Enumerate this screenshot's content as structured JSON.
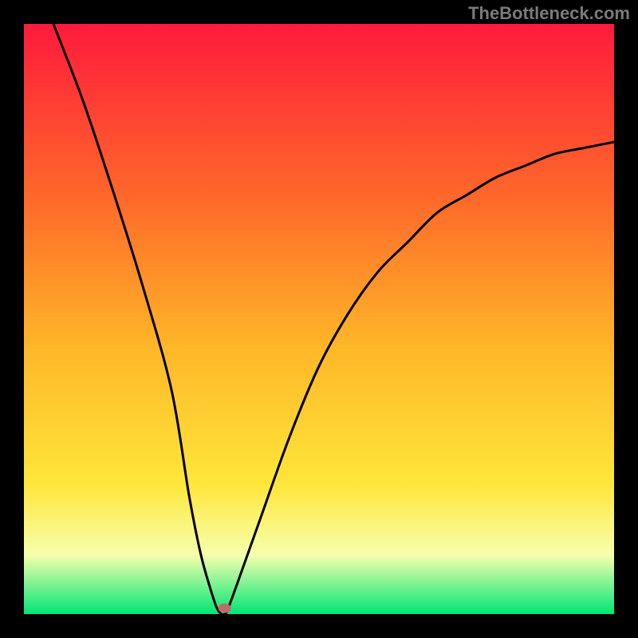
{
  "watermark": "TheBottleneck.com",
  "colors": {
    "bg_black": "#000000",
    "grad_top": "#ff1a3c",
    "grad_upper_mid": "#ff6a2a",
    "grad_mid": "#ffb728",
    "grad_lower_mid": "#ffe63a",
    "grad_lower": "#f7ffad",
    "grad_bottom": "#00e676",
    "curve": "#000000",
    "marker": "#c06a6a"
  },
  "chart_data": {
    "type": "line",
    "title": "",
    "xlabel": "",
    "ylabel": "",
    "xlim": [
      0,
      100
    ],
    "ylim": [
      0,
      100
    ],
    "x": [
      5,
      10,
      15,
      20,
      25,
      28,
      30,
      32,
      33,
      34,
      35,
      40,
      45,
      50,
      55,
      60,
      65,
      70,
      75,
      80,
      85,
      90,
      95,
      100
    ],
    "values": [
      100,
      87,
      72,
      56,
      38,
      20,
      10,
      3,
      0.5,
      0,
      2,
      16,
      30,
      42,
      51,
      58,
      63,
      68,
      71,
      74,
      76,
      78,
      79,
      80
    ],
    "minimum_x": 34,
    "minimum_y": 0,
    "marker": {
      "x": 34,
      "y": 1
    },
    "gradient_stops": [
      {
        "offset": 0,
        "color": "#ff1a3c"
      },
      {
        "offset": 30,
        "color": "#ff6a2a"
      },
      {
        "offset": 55,
        "color": "#ffb728"
      },
      {
        "offset": 78,
        "color": "#ffe63a"
      },
      {
        "offset": 90,
        "color": "#f7ffad"
      },
      {
        "offset": 100,
        "color": "#00e676"
      }
    ]
  }
}
